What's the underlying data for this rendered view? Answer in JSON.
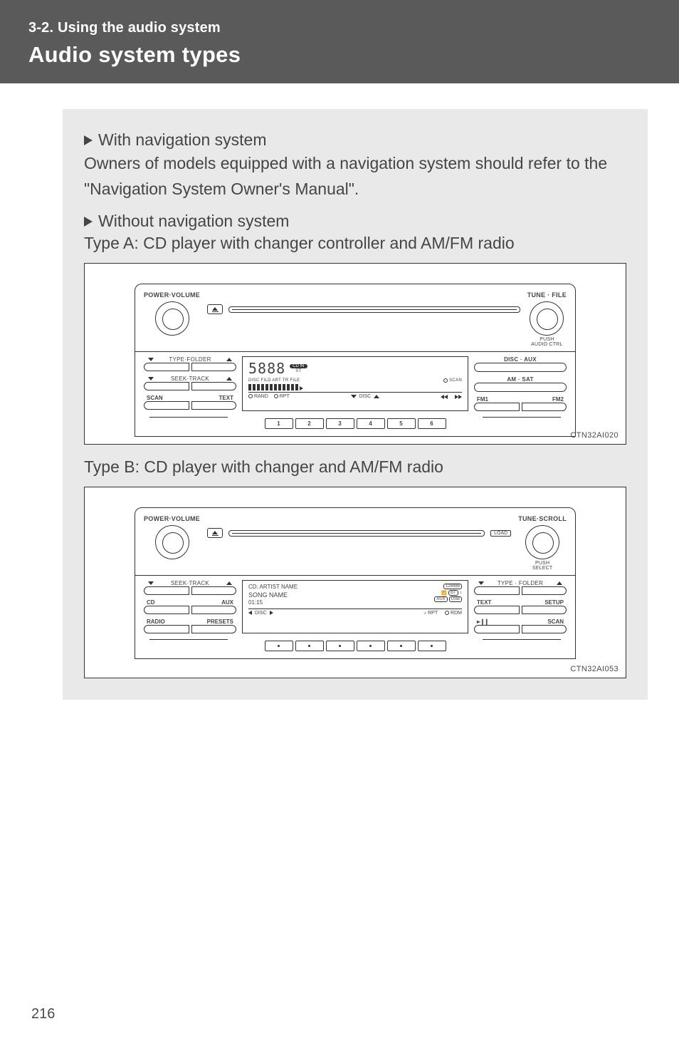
{
  "header": {
    "section": "3-2. Using the audio system",
    "title": "Audio system types"
  },
  "content": {
    "bullet1": "With navigation system",
    "para1": "Owners of models equipped with a navigation system should refer to the \"Navigation System Owner's Manual\".",
    "bullet2": "Without navigation system",
    "typeA_label": "Type A: CD player with changer controller and AM/FM radio",
    "typeB_label": "Type B: CD player with changer and AM/FM radio"
  },
  "figA": {
    "id": "CTN32AI020",
    "left_knob_top": "POWER·VOLUME",
    "right_knob_top": "TUNE · FILE",
    "right_knob_sub1": "PUSH",
    "right_knob_sub2": "AUDIO CTRL",
    "eject": "eject",
    "left_row1_label": "TYPE·FOLDER",
    "left_row2_label": "SEEK·TRACK",
    "left_row3_l": "SCAN",
    "left_row3_r": "TEXT",
    "screen_seg": "5888",
    "screen_cdin": "CD IN",
    "screen_st": "ST",
    "screen_small": "DISC    FILD  ART  TR  FILE",
    "screen_scan": "SCAN",
    "screen_bot_rand": "RAND",
    "screen_bot_rpt": "RPT",
    "screen_bot_disc": "DISC",
    "right_row1": "DISC · AUX",
    "right_row2": "AM · SAT",
    "right_row3_l": "FM1",
    "right_row3_r": "FM2",
    "preset_numbers": [
      "1",
      "2",
      "3",
      "4",
      "5",
      "6"
    ]
  },
  "figB": {
    "id": "CTN32AI053",
    "left_knob_top": "POWER·VOLUME",
    "right_knob_top": "TUNE·SCROLL",
    "right_knob_sub1": "PUSH",
    "right_knob_sub2": "SELECT",
    "eject": "eject",
    "load": "LOAD",
    "left_row1_label": "SEEK·TRACK",
    "left_row2_l": "CD",
    "left_row2_r": "AUX",
    "left_row3_l": "RADIO",
    "left_row3_r": "PRESETS",
    "screen_l1": "CD:  ARTIST NAME",
    "screen_l2": "SONG NAME",
    "screen_l3": "01:15",
    "screen_trk": "128488",
    "screen_bt": "BT",
    "screen_aux": "AUX",
    "screen_usb": "USB",
    "screen_disc": "DISC",
    "screen_rpt": "RPT",
    "screen_rdm": "RDM",
    "right_row1_label": "TYPE · FOLDER",
    "right_row2_l": "TEXT",
    "right_row2_r": "SETUP",
    "right_row3_l": "▶·❚❚",
    "right_row3_r": "SCAN"
  },
  "page_number": "216"
}
